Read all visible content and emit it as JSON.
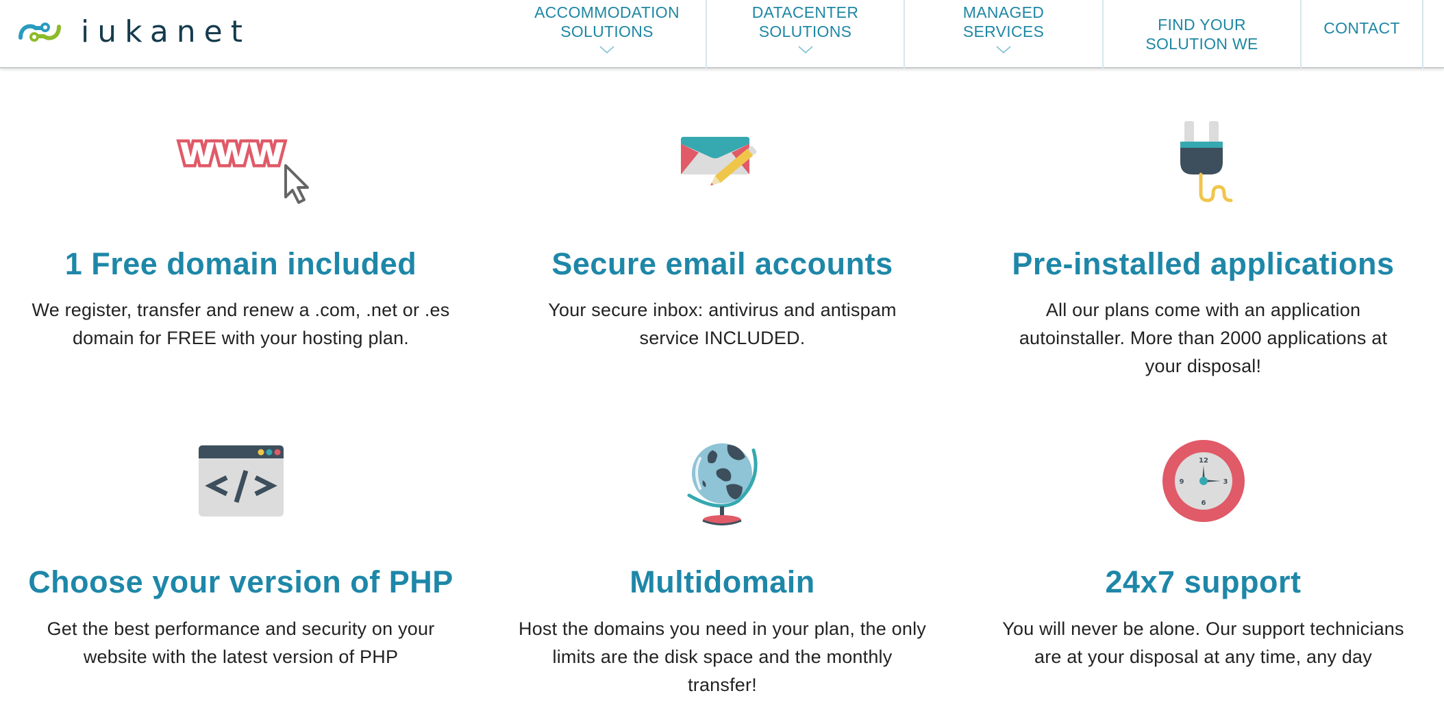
{
  "header": {
    "logo_text": "iukanet",
    "nav": [
      {
        "label_line1": "ACCOMMODATION",
        "label_line2": "SOLUTIONS",
        "has_dropdown": true
      },
      {
        "label_line1": "DATACENTER",
        "label_line2": "SOLUTIONS",
        "has_dropdown": true
      },
      {
        "label_line1": "MANAGED",
        "label_line2": "SERVICES",
        "has_dropdown": true
      },
      {
        "label_line1": "FIND YOUR",
        "label_line2": "SOLUTION WE",
        "has_dropdown": false
      },
      {
        "label_line1": "CONTACT",
        "label_line2": "",
        "has_dropdown": false
      }
    ]
  },
  "features": [
    {
      "icon": "www-cursor-icon",
      "title": "1 Free domain included",
      "lines": [
        "We register, transfer and renew a .com, .net or .es",
        "domain for FREE with your hosting plan."
      ]
    },
    {
      "icon": "email-pencil-icon",
      "title": "Secure email accounts",
      "lines": [
        "Your secure inbox: antivirus and antispam",
        "service INCLUDED."
      ]
    },
    {
      "icon": "plug-icon",
      "title": "Pre-installed applications",
      "lines": [
        "All our plans come with an application",
        "autoinstaller. More than 2000 applications at",
        "your disposal!"
      ]
    },
    {
      "icon": "code-window-icon",
      "title": "Choose your version of PHP",
      "lines": [
        "Get the best performance and security on your",
        "website with the latest version of PHP"
      ]
    },
    {
      "icon": "globe-icon",
      "title": "Multidomain",
      "lines": [
        "Host the domains you need in your plan, the only",
        "limits are the disk space and the monthly",
        "transfer!"
      ]
    },
    {
      "icon": "clock-icon",
      "title": "24x7 support",
      "lines": [
        "You will never be alone. Our support technicians",
        "are at your disposal at any time, any day"
      ],
      "clock_numbers": [
        "12",
        "3",
        "6",
        "9"
      ]
    }
  ],
  "colors": {
    "accent": "#1e87a8",
    "nav_text": "#1e87a3",
    "logo_dark": "#163b4d",
    "logo_blue": "#2a9bbf",
    "logo_green": "#8cbb2a",
    "icon_red": "#e05a68",
    "icon_teal": "#36a8b0",
    "icon_dark": "#3d4f5c",
    "icon_yellow": "#f0c64a",
    "icon_grey": "#dcdcdc"
  }
}
